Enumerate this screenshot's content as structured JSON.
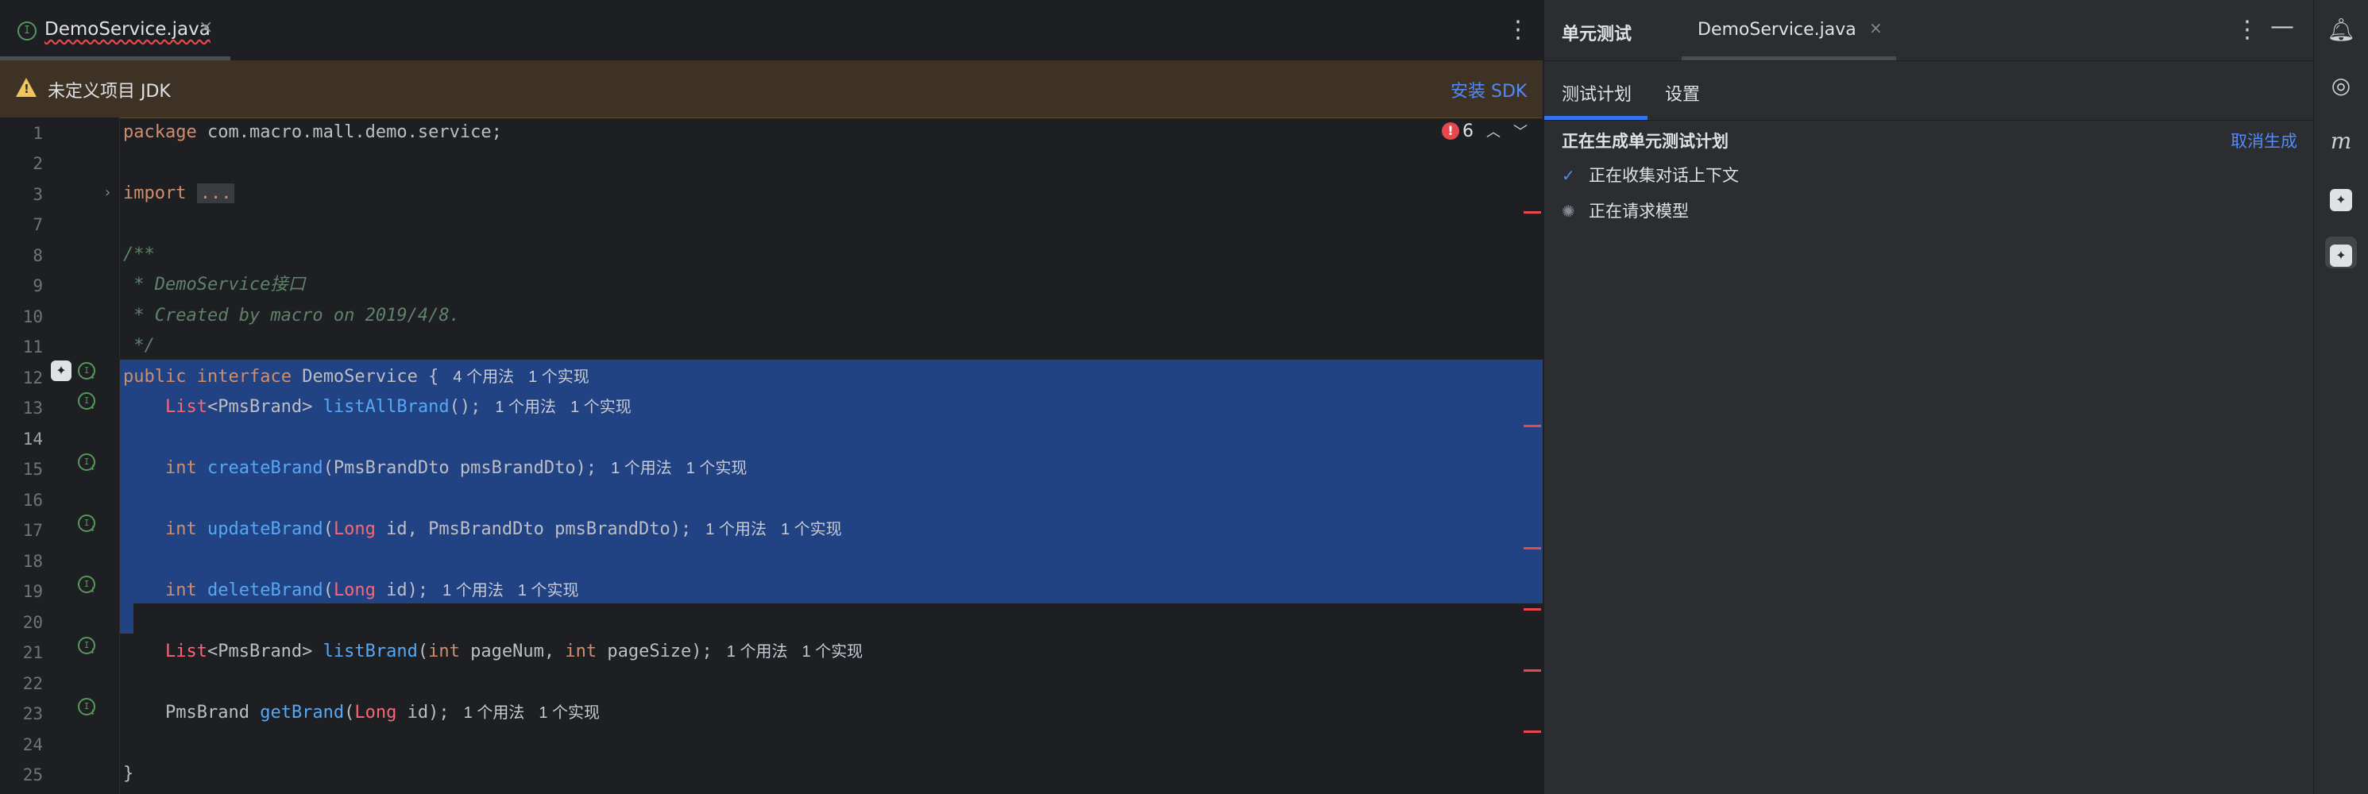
{
  "editor": {
    "tab": {
      "icon": "interface-icon",
      "icon_glyph": "I",
      "label": "DemoService.java",
      "close": "×"
    },
    "more": "⋮",
    "banner": {
      "text": "未定义项目 JDK",
      "link": "安装 SDK"
    },
    "errors": {
      "count": "6",
      "up": "︿",
      "down": "﹀"
    },
    "gutter": {
      "line_numbers": [
        "1",
        "2",
        "3",
        "7",
        "8",
        "9",
        "10",
        "11",
        "12",
        "13",
        "14",
        "15",
        "16",
        "17",
        "18",
        "19",
        "20",
        "21",
        "22",
        "23",
        "24",
        "25"
      ]
    },
    "code": {
      "package": {
        "kw": "package",
        "rest": " com.macro.mall.demo.service;"
      },
      "import": {
        "kw": "import",
        "folded": "..."
      },
      "doc_open": "/**",
      "doc_line1_pre": " * DemoService",
      "doc_line1_cn": "接口",
      "doc_line2": " * Created by macro on 2019/4/8.",
      "doc_close": " */",
      "iface": {
        "kw1": "public",
        "kw2": "interface",
        "name": " DemoService {",
        "hint1": "4 个用法",
        "hint2": "1 个实现"
      },
      "m1": {
        "indent": "    ",
        "ty": "List",
        "rest1": "<PmsBrand> ",
        "fn": "listAllBrand",
        "rest2": "();",
        "hint1": "1 个用法",
        "hint2": "1 个实现"
      },
      "m2": {
        "indent": "    ",
        "kw": "int",
        "sp": " ",
        "fn": "createBrand",
        "rest": "(PmsBrandDto pmsBrandDto);",
        "hint1": "1 个用法",
        "hint2": "1 个实现"
      },
      "m3": {
        "indent": "    ",
        "kw": "int",
        "sp": " ",
        "fn": "updateBrand",
        "p1": "(",
        "ty": "Long",
        "rest": " id, PmsBrandDto pmsBrandDto);",
        "hint1": "1 个用法",
        "hint2": "1 个实现"
      },
      "m4": {
        "indent": "    ",
        "kw": "int",
        "sp": " ",
        "fn": "deleteBrand",
        "p1": "(",
        "ty": "Long",
        "rest": " id);",
        "hint1": "1 个用法",
        "hint2": "1 个实现"
      },
      "m5": {
        "indent": "    ",
        "ty": "List",
        "rest1": "<PmsBrand> ",
        "fn": "listBrand",
        "p1": "(",
        "kw1": "int",
        "mid": " pageNum, ",
        "kw2": "int",
        "rest2": " pageSize);",
        "hint1": "1 个用法",
        "hint2": "1 个实现"
      },
      "m6": {
        "indent": "    ",
        "pre": "PmsBrand ",
        "fn": "getBrand",
        "p1": "(",
        "ty": "Long",
        "rest": " id);",
        "hint1": "1 个用法",
        "hint2": "1 个实现"
      },
      "close": "}"
    }
  },
  "panel": {
    "title": "单元测试",
    "tab_label": "DemoService.java",
    "tab_close": "×",
    "more": "⋮",
    "minimize": "—",
    "subtabs": [
      "测试计划",
      "设置"
    ],
    "status_title": "正在生成单元测试计划",
    "cancel": "取消生成",
    "steps": [
      {
        "icon": "checkmark-icon",
        "glyph": "✓",
        "label": "正在收集对话上下文"
      },
      {
        "icon": "spinner-icon",
        "glyph": "✺",
        "label": "正在请求模型"
      }
    ]
  },
  "rail": {
    "icons": [
      {
        "name": "notifications-bell-icon",
        "glyph": "🔔︎"
      },
      {
        "name": "ai-assistant-swirl-icon",
        "glyph": "◎"
      },
      {
        "name": "m-plugin-icon",
        "glyph": "m"
      },
      {
        "name": "ai-hex-icon",
        "glyph": "✦"
      },
      {
        "name": "ai-hex-active-icon",
        "glyph": "✦"
      }
    ]
  },
  "colors": {
    "background": "#1e1f22",
    "panel": "#2b2d30",
    "selection": "#214283",
    "keyword": "#cf8e6d",
    "type": "#fa6675",
    "function": "#56a8f5",
    "accent": "#548af7",
    "error": "#e5484d",
    "warning_bg": "#3d3223"
  }
}
